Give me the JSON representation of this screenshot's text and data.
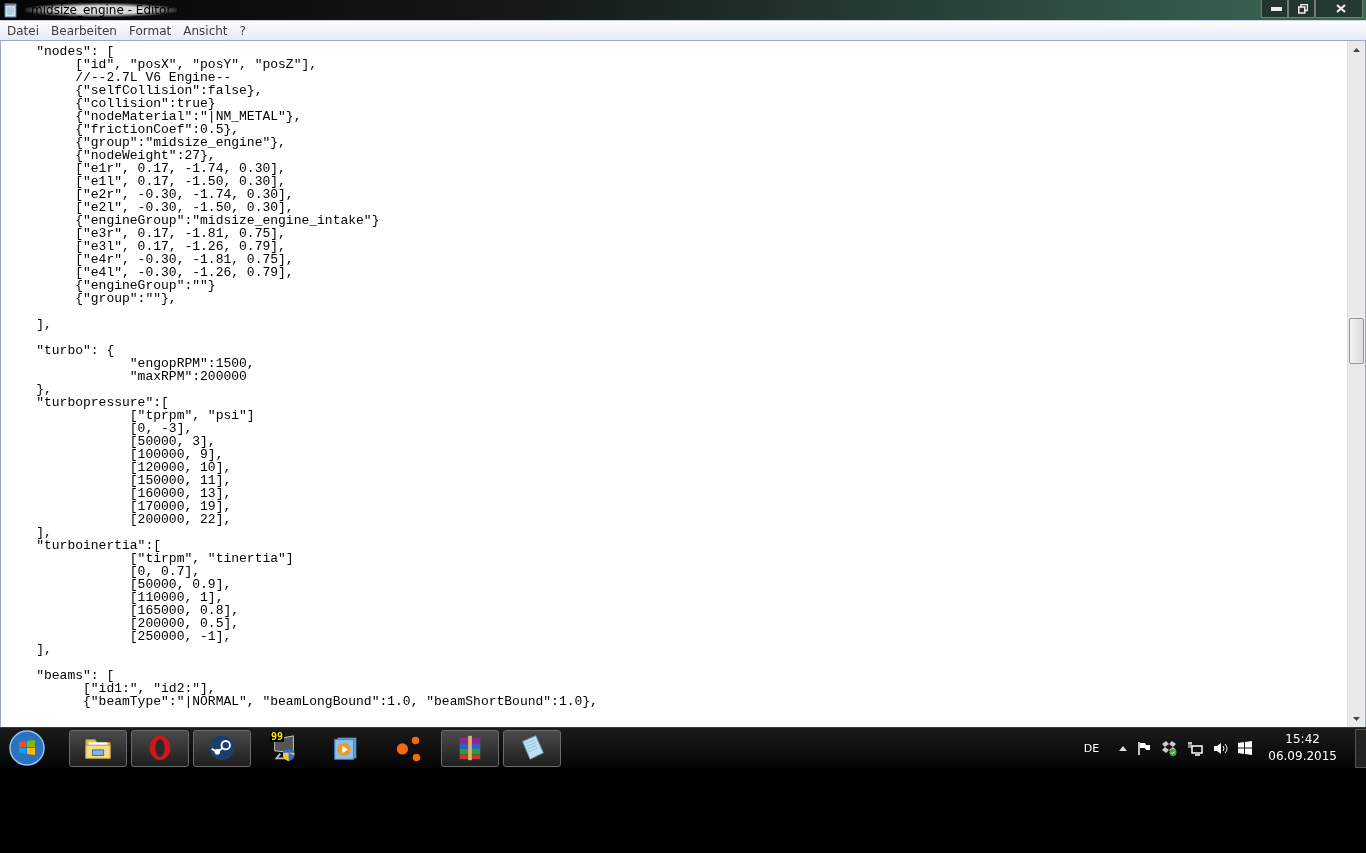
{
  "window": {
    "title": "midsize_engine - Editor"
  },
  "menu": [
    "Datei",
    "Bearbeiten",
    "Format",
    "Ansicht",
    "?"
  ],
  "document": {
    "blocks": [
      [
        "    \"nodes\": [",
        "         [\"id\", \"posX\", \"posY\", \"posZ\"],",
        "         //--2.7L V6 Engine--",
        "         {\"selfCollision\":false},",
        "         {\"collision\":true}",
        "         {\"nodeMaterial\":\"|NM_METAL\"},",
        "         {\"frictionCoef\":0.5},",
        "         {\"group\":\"midsize_engine\"},",
        "         {\"nodeWeight\":27},",
        "         [\"e1r\", 0.17, -1.74, 0.30],",
        "         [\"e1l\", 0.17, -1.50, 0.30],",
        "         [\"e2r\", -0.30, -1.74, 0.30],",
        "         [\"e2l\", -0.30, -1.50, 0.30],",
        "         {\"engineGroup\":\"midsize_engine_intake\"}",
        "         [\"e3r\", 0.17, -1.81, 0.75],",
        "         [\"e3l\", 0.17, -1.26, 0.79],",
        "         [\"e4r\", -0.30, -1.81, 0.75],",
        "         [\"e4l\", -0.30, -1.26, 0.79],",
        "         {\"engineGroup\":\"\"}",
        "         {\"group\":\"\"},"
      ],
      [
        "    ],"
      ],
      [
        "    \"turbo\": {",
        "                \"engopRPM\":1500,",
        "                \"maxRPM\":200000",
        "    },",
        "    \"turbopressure\":[",
        "                [\"tprpm\", \"psi\"]",
        "                [0, -3],",
        "                [50000, 3],",
        "                [100000, 9],",
        "                [120000, 10],",
        "                [150000, 11],",
        "                [160000, 13],",
        "                [170000, 19],",
        "                [200000, 22],",
        "    ],",
        "    \"turboinertia\":[",
        "                [\"tirpm\", \"tinertia\"]",
        "                [0, 0.7],",
        "                [50000, 0.9],",
        "                [110000, 1],",
        "                [165000, 0.8],",
        "                [200000, 0.5],",
        "                [250000, -1],",
        "    ],"
      ],
      [
        "    \"beams\": [",
        "          [\"id1:\", \"id2:\"],",
        "          {\"beamType\":\"|NORMAL\", \"beamLongBound\":1.0, \"beamShortBound\":1.0},"
      ]
    ]
  },
  "taskbar": {
    "apps": [
      {
        "kind": "folder",
        "running": true
      },
      {
        "kind": "opera",
        "running": true
      },
      {
        "kind": "steam",
        "running": true
      },
      {
        "kind": "monitor",
        "running": false,
        "badge": "99"
      },
      {
        "kind": "player",
        "running": false
      },
      {
        "kind": "dots",
        "running": false
      },
      {
        "kind": "archive",
        "running": true
      },
      {
        "kind": "notepad",
        "running": true
      }
    ]
  },
  "tray": {
    "language": "DE",
    "time": "15:42",
    "date": "06.09.2015"
  }
}
